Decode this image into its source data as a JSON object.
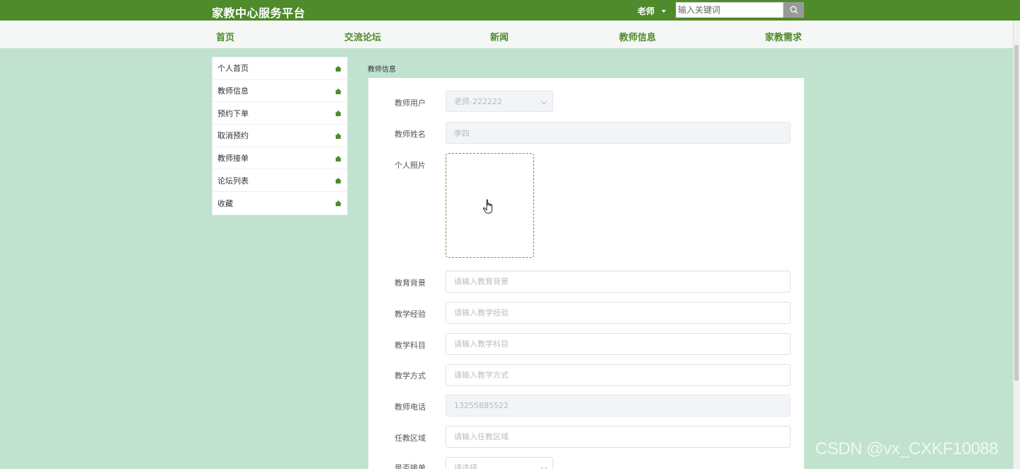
{
  "header": {
    "brand": "家教中心服务平台",
    "user_label": "老师",
    "search_placeholder": "输入关键词"
  },
  "nav": {
    "items": [
      "首页",
      "交流论坛",
      "新闻",
      "教师信息",
      "家教需求"
    ]
  },
  "sidebar": {
    "items": [
      "个人首页",
      "教师信息",
      "预约下单",
      "取消预约",
      "教师接单",
      "论坛列表",
      "收藏"
    ]
  },
  "breadcrumb": "教师信息",
  "form": {
    "teacher_user": {
      "label": "教师用户",
      "value": "老师-222222"
    },
    "teacher_name": {
      "label": "教师姓名",
      "value": "李四"
    },
    "photo": {
      "label": "个人照片"
    },
    "education": {
      "label": "教育背景",
      "placeholder": "请输入教育背景"
    },
    "experience": {
      "label": "教学经验",
      "placeholder": "请输入教学经验"
    },
    "subject": {
      "label": "教学科目",
      "placeholder": "请输入教学科目"
    },
    "method": {
      "label": "教学方式",
      "placeholder": "请输入教学方式"
    },
    "phone": {
      "label": "教师电话",
      "value": "13255885522"
    },
    "area": {
      "label": "任教区域",
      "placeholder": "请输入任教区域"
    },
    "accept_order": {
      "label": "是否接单",
      "placeholder": "请选择"
    }
  },
  "watermark": "CSDN @vx_CXKF10088",
  "colors": {
    "primary": "#4f8a2b",
    "background": "#c0e2cf"
  }
}
